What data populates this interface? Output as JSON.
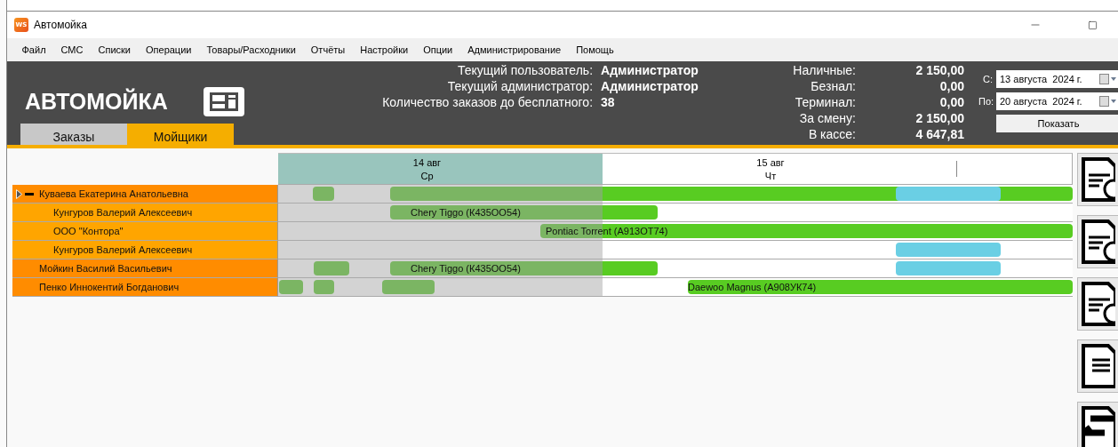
{
  "window": {
    "app_icon": "WS",
    "title": "Автомойка"
  },
  "menu": [
    "Файл",
    "СМС",
    "Списки",
    "Операции",
    "Товары/Расходники",
    "Отчёты",
    "Настройки",
    "Опции",
    "Администрирование",
    "Помощь"
  ],
  "header": {
    "logo": "АВТОМОЙКА",
    "info": [
      {
        "label": "Текущий пользователь:",
        "value": "Администратор"
      },
      {
        "label": "Текущий администратор:",
        "value": "Администратор"
      },
      {
        "label": "Количество заказов до бесплатного:",
        "value": "38"
      }
    ],
    "totals": [
      {
        "label": "Наличные:",
        "value": "2 150,00"
      },
      {
        "label": "Безнал:",
        "value": "0,00"
      },
      {
        "label": "Терминал:",
        "value": "0,00"
      },
      {
        "label": "За смену:",
        "value": "2 150,00"
      },
      {
        "label": "В кассе:",
        "value": "4 647,81"
      }
    ],
    "date_from": {
      "label": "С:",
      "value": "13 августа  2024 г."
    },
    "date_to": {
      "label": "По:",
      "value": "20 августа  2024 г."
    },
    "show_button": "Показать"
  },
  "tabs": [
    {
      "label": "Заказы",
      "selected": false
    },
    {
      "label": "Мойщики",
      "selected": true
    }
  ],
  "timeline": {
    "days": [
      {
        "date": "14 авг",
        "weekday": "Ср",
        "past": true
      },
      {
        "date": "15 авг",
        "weekday": "Чт",
        "past": false
      }
    ],
    "workers": [
      {
        "name": "Куваева Екатерина Анатольевна",
        "current": true,
        "expanded": true,
        "bars": [
          {
            "kind": "order"
          },
          {
            "kind": "order"
          },
          {
            "kind": "reserved"
          }
        ],
        "children": [
          {
            "name": "Кунгуров Валерий Алексеевич",
            "current": false,
            "bars": [
              {
                "kind": "order",
                "label": "Chery Tiggo (К435ОО54)"
              }
            ]
          },
          {
            "name": "ООО \"Контора\"",
            "current": false,
            "bars": [
              {
                "kind": "order",
                "label": "Pontiac Torrent (А913ОТ74)"
              }
            ]
          },
          {
            "name": "Кунгуров Валерий Алексеевич",
            "current": false,
            "bars": [
              {
                "kind": "reserved"
              }
            ]
          }
        ]
      },
      {
        "name": "Мойкин Василий Васильевич",
        "current": false,
        "bars": [
          {
            "kind": "order"
          },
          {
            "kind": "order",
            "label": "Chery Tiggo (К435ОО54)"
          },
          {
            "kind": "reserved"
          }
        ]
      },
      {
        "name": "Пенко Иннокентий Богданович",
        "current": false,
        "bars": [
          {
            "kind": "order"
          },
          {
            "kind": "order"
          },
          {
            "kind": "order"
          },
          {
            "kind": "order",
            "label": "Daewoo Magnus (А908УК74)"
          }
        ]
      }
    ]
  }
}
